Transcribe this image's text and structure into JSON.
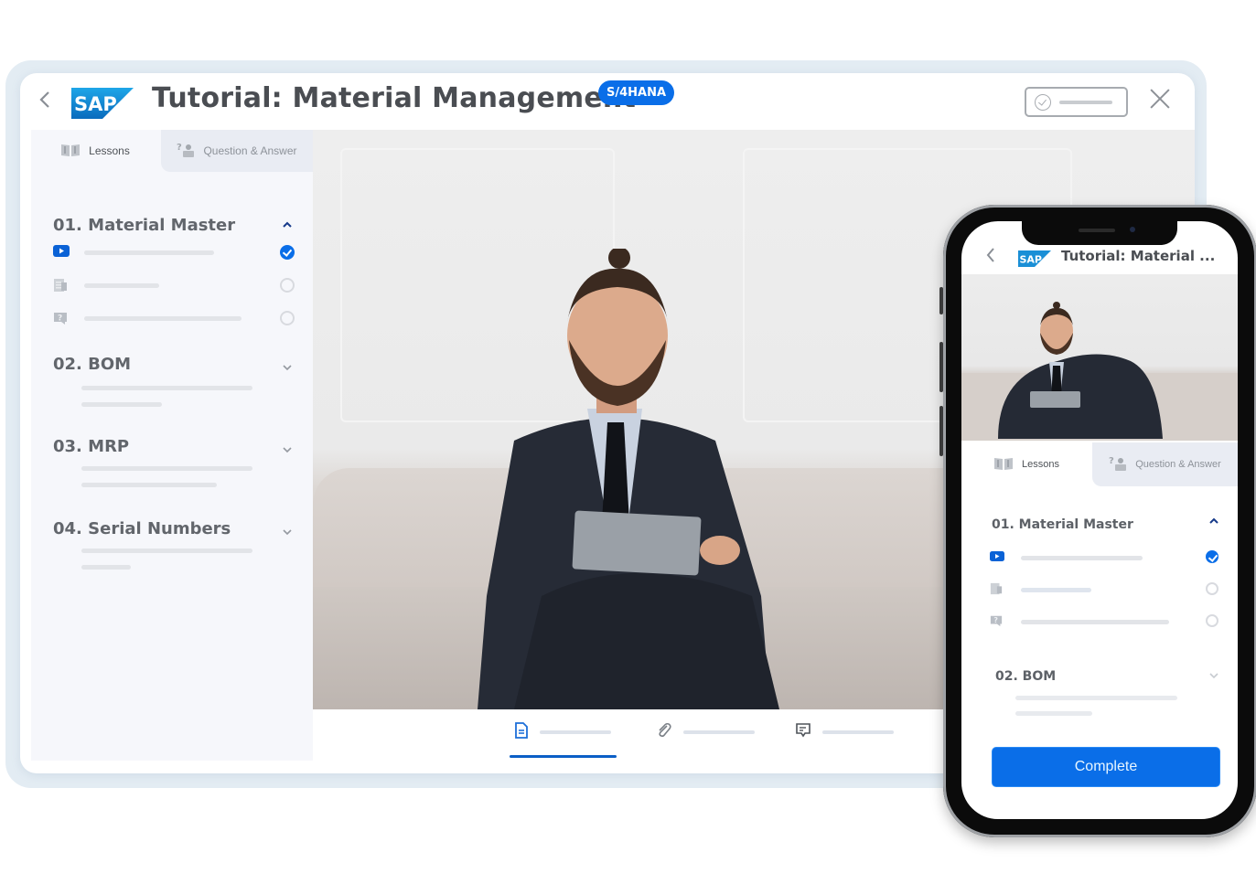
{
  "desktop": {
    "title": "Tutorial: Material Management",
    "badge": "S/4HANA",
    "logo_text": "SAP",
    "tabs": [
      {
        "label": "Lessons",
        "icon": "book-icon",
        "active": true
      },
      {
        "label": "Question & Answer",
        "icon": "question-answer-icon",
        "active": false
      }
    ],
    "sections": [
      {
        "title": "01. Material Master",
        "expanded": true,
        "items": [
          {
            "type": "video",
            "icon": "video-play-icon",
            "completed": true
          },
          {
            "type": "document",
            "icon": "document-icon",
            "completed": false
          },
          {
            "type": "quiz",
            "icon": "quiz-icon",
            "completed": false
          }
        ]
      },
      {
        "title": "02. BOM",
        "expanded": false
      },
      {
        "title": "03. MRP",
        "expanded": false
      },
      {
        "title": "04. Serial Numbers",
        "expanded": false
      }
    ],
    "bottom_tabs": [
      {
        "icon": "document-icon",
        "active": true
      },
      {
        "icon": "attachment-icon",
        "active": false
      },
      {
        "icon": "comment-icon",
        "active": false
      }
    ]
  },
  "mobile": {
    "title": "Tutorial: Material ...",
    "logo_text": "SAP",
    "tabs": [
      {
        "label": "Lessons",
        "active": true
      },
      {
        "label": "Question & Answer",
        "active": false
      }
    ],
    "sections": [
      {
        "title": "01. Material Master",
        "expanded": true
      },
      {
        "title": "02. BOM",
        "expanded": false
      }
    ],
    "complete_label": "Complete"
  },
  "colors": {
    "accent": "#0a6ee8",
    "sap_blue": "#1a8fd6",
    "text": "#4a4d52"
  }
}
